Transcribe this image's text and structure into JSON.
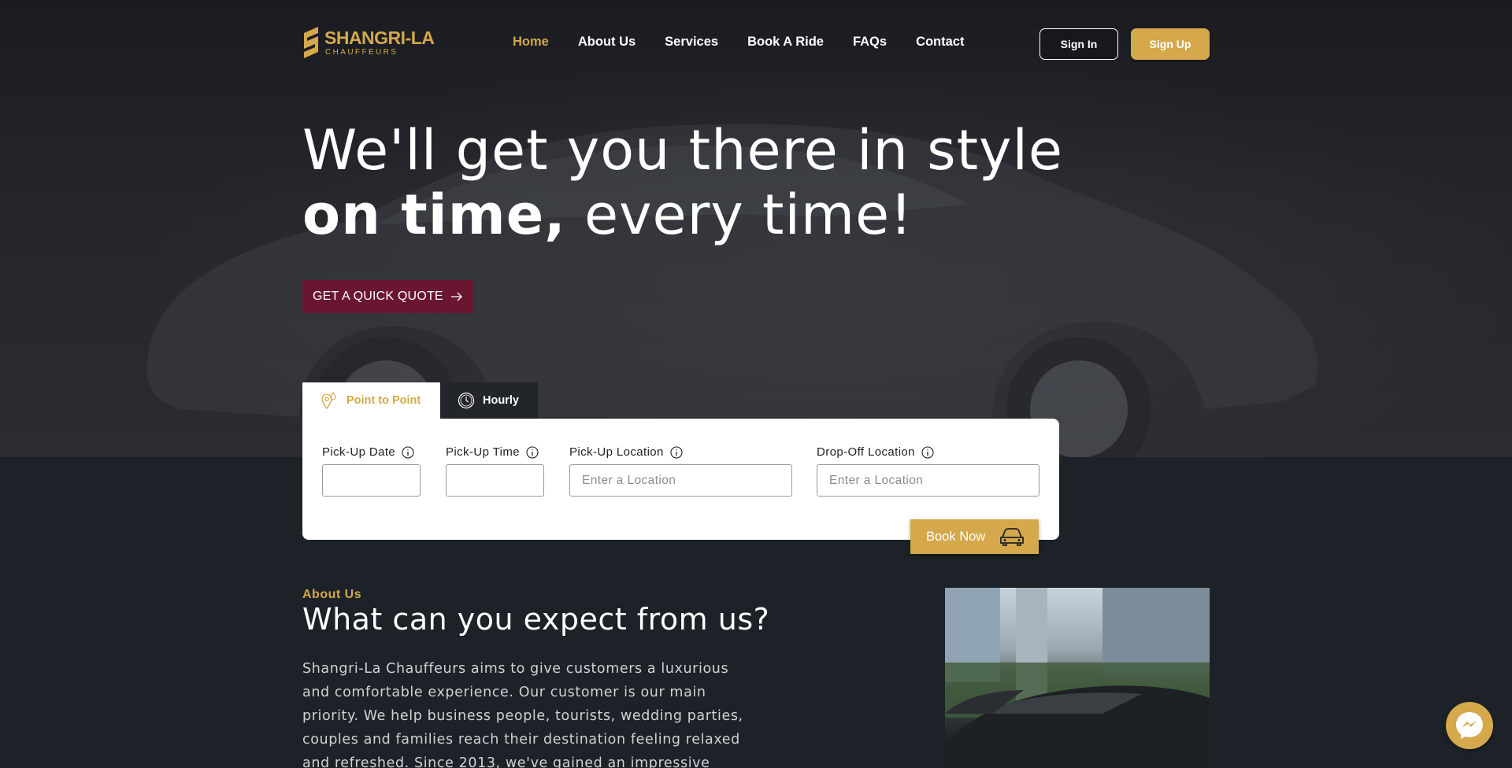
{
  "brand": {
    "name": "SHANGRI-LA",
    "tagline": "CHAUFFEURS",
    "accent": "#d4a84b",
    "quote_color": "#6b1631"
  },
  "nav": {
    "items": [
      {
        "label": "Home",
        "active": true
      },
      {
        "label": "About Us"
      },
      {
        "label": "Services"
      },
      {
        "label": "Book A Ride"
      },
      {
        "label": "FAQs"
      },
      {
        "label": "Contact"
      }
    ],
    "signin_label": "Sign In",
    "signup_label": "Sign Up"
  },
  "hero": {
    "line1": "We'll get you there in style",
    "line2_bold": "on time,",
    "line2_rest": " every time!",
    "quote_label": "GET A QUICK QUOTE",
    "quote_icon": "arrow-right-icon"
  },
  "booking": {
    "tabs": [
      {
        "label": "Point to Point",
        "icon": "map-pin-icon",
        "active": true
      },
      {
        "label": "Hourly",
        "icon": "clock-icon"
      }
    ],
    "fields": {
      "pickup_date": {
        "label": "Pick-Up Date",
        "value": "",
        "placeholder": ""
      },
      "pickup_time": {
        "label": "Pick-Up Time",
        "value": "",
        "placeholder": ""
      },
      "pickup_location": {
        "label": "Pick-Up Location",
        "value": "",
        "placeholder": "Enter a Location"
      },
      "dropoff_location": {
        "label": "Drop-Off Location",
        "value": "",
        "placeholder": "Enter a Location"
      }
    },
    "book_label": "Book Now",
    "book_icon": "car-icon"
  },
  "about": {
    "kicker": "About Us",
    "title": "What can you expect from us?",
    "body": "Shangri-La Chauffeurs aims to give customers a luxurious and comfortable experience. Our customer is our main priority. We help business people, tourists, wedding parties, couples and families reach their destination feeling relaxed and refreshed. Since 2013, we've gained an impressive reputation for our"
  },
  "chat": {
    "icon": "messenger-icon"
  }
}
